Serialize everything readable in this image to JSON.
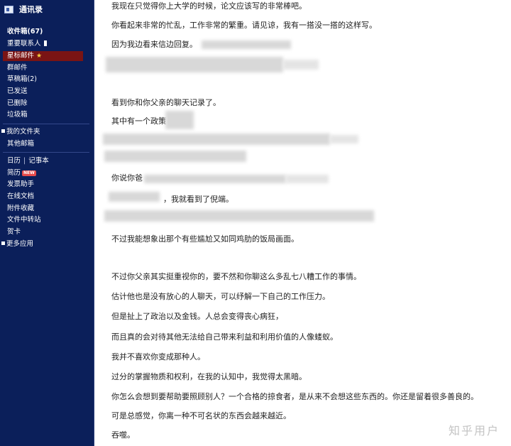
{
  "sidebar": {
    "contacts_label": "通讯录",
    "items": {
      "inbox": "收件箱(67)",
      "important": "重要联系人",
      "starred": "星标邮件",
      "group": "群邮件",
      "drafts": "草稿箱(2)",
      "sent": "已发送",
      "deleted": "已删除",
      "junk": "垃圾箱",
      "my_folders": "我的文件夹",
      "other_mail": "其他邮箱",
      "calendar": "日历",
      "separator": "|",
      "notes": "记事本",
      "journal": "简历",
      "new_badge": "NEW",
      "invoice": "发票助手",
      "online_docs": "在线文档",
      "attachments": "附件收藏",
      "file_transfer": "文件中转站",
      "cards": "贺卡",
      "more_apps": "更多应用"
    }
  },
  "email": {
    "lines": [
      "我现在只觉得你上大学的时候，论文应该写的非常棒吧。",
      "你看起来非常的忙乱，工作非常的繁重。请见谅，我有一搭没一搭的这样写。",
      "因为我边看来信边回复。",
      "看到你和你父亲的聊天记录了。",
      "其中有一个政策",
      "你说你爸",
      "，我就看到了倪端。",
      "不过我能想象出那个有些尴尬又如同鸡肋的饭局画面。",
      "不过你父亲其实挺重视你的，要不然和你聊这么多乱七八糟工作的事情。",
      "估计他也是没有放心的人聊天，可以纾解一下自己的工作压力。",
      "但是扯上了政治以及金钱。人总会变得丧心病狂，",
      "而且真的会对待其他无法给自己带来利益和利用价值的人像蝼蚁。",
      "我并不喜欢你变成那种人。",
      "过分的掌握物质和权利，在我的认知中，我觉得太黑暗。",
      "你怎么会想到要帮助要照顾别人？一个合格的掠食者，是从来不会想这些东西的。你还是留着很多善良的。",
      "可是总感觉，你离一种不可名状的东西会越来越近。",
      "吞噬。"
    ]
  },
  "watermark": "知乎用户",
  "colors": {
    "sidebar_bg": "#0b1f5a",
    "active_item_bg": "#7a1414",
    "star": "#f4d03f"
  }
}
